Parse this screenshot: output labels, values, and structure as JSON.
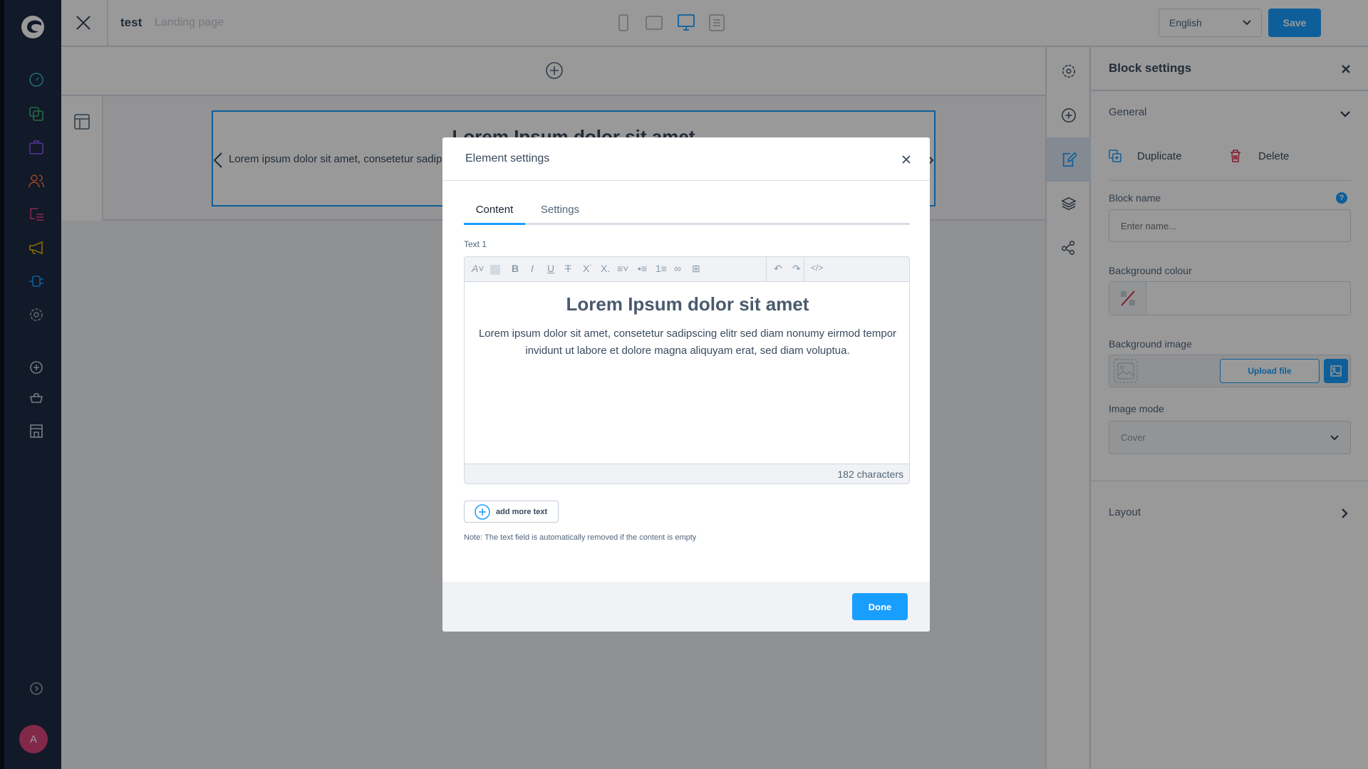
{
  "topbar": {
    "title": "test",
    "subtitle": "Landing page",
    "language": "English",
    "save_label": "Save"
  },
  "canvas": {
    "block_heading": "Lorem Ipsum dolor sit amet",
    "block_text": "Lorem ipsum dolor sit amet, consetetur sadips"
  },
  "sidebar": {
    "avatar": "A",
    "icons": [
      "dashboard-icon",
      "catalog-icon",
      "orders-icon",
      "customers-icon",
      "content-icon",
      "marketing-icon",
      "extensions-icon",
      "settings-icon",
      "add-icon",
      "basket-icon",
      "store-icon",
      "help-icon"
    ],
    "colors": [
      "#2fb4c8",
      "#37b56f",
      "#8b5cf6",
      "#f0783c",
      "#e0478a",
      "#e6b800",
      "#189eff",
      "#9aa8b8"
    ]
  },
  "block_settings": {
    "title": "Block settings",
    "general": "General",
    "duplicate": "Duplicate",
    "delete": "Delete",
    "block_name_label": "Block name",
    "block_name_placeholder": "Enter name...",
    "bg_colour_label": "Background colour",
    "bg_image_label": "Background image",
    "upload_label": "Upload file",
    "image_mode_label": "Image mode",
    "image_mode_value": "Cover",
    "layout": "Layout"
  },
  "modal": {
    "title": "Element settings",
    "tabs": [
      {
        "label": "Content",
        "active": true
      },
      {
        "label": "Settings",
        "active": false
      }
    ],
    "field_label": "Text 1",
    "heading": "Lorem Ipsum dolor sit amet",
    "paragraph": "Lorem ipsum dolor sit amet, consetetur sadipscing elitr sed diam nonumy eirmod tempor invidunt ut labore et dolore magna aliquyam erat, sed diam voluptua.",
    "char_count": "182 characters",
    "add_more": "add more text",
    "note": "Note: The text field is automatically removed if the content is empty",
    "done": "Done"
  },
  "colors": {
    "accent": "#189eff",
    "danger": "#de294c"
  }
}
